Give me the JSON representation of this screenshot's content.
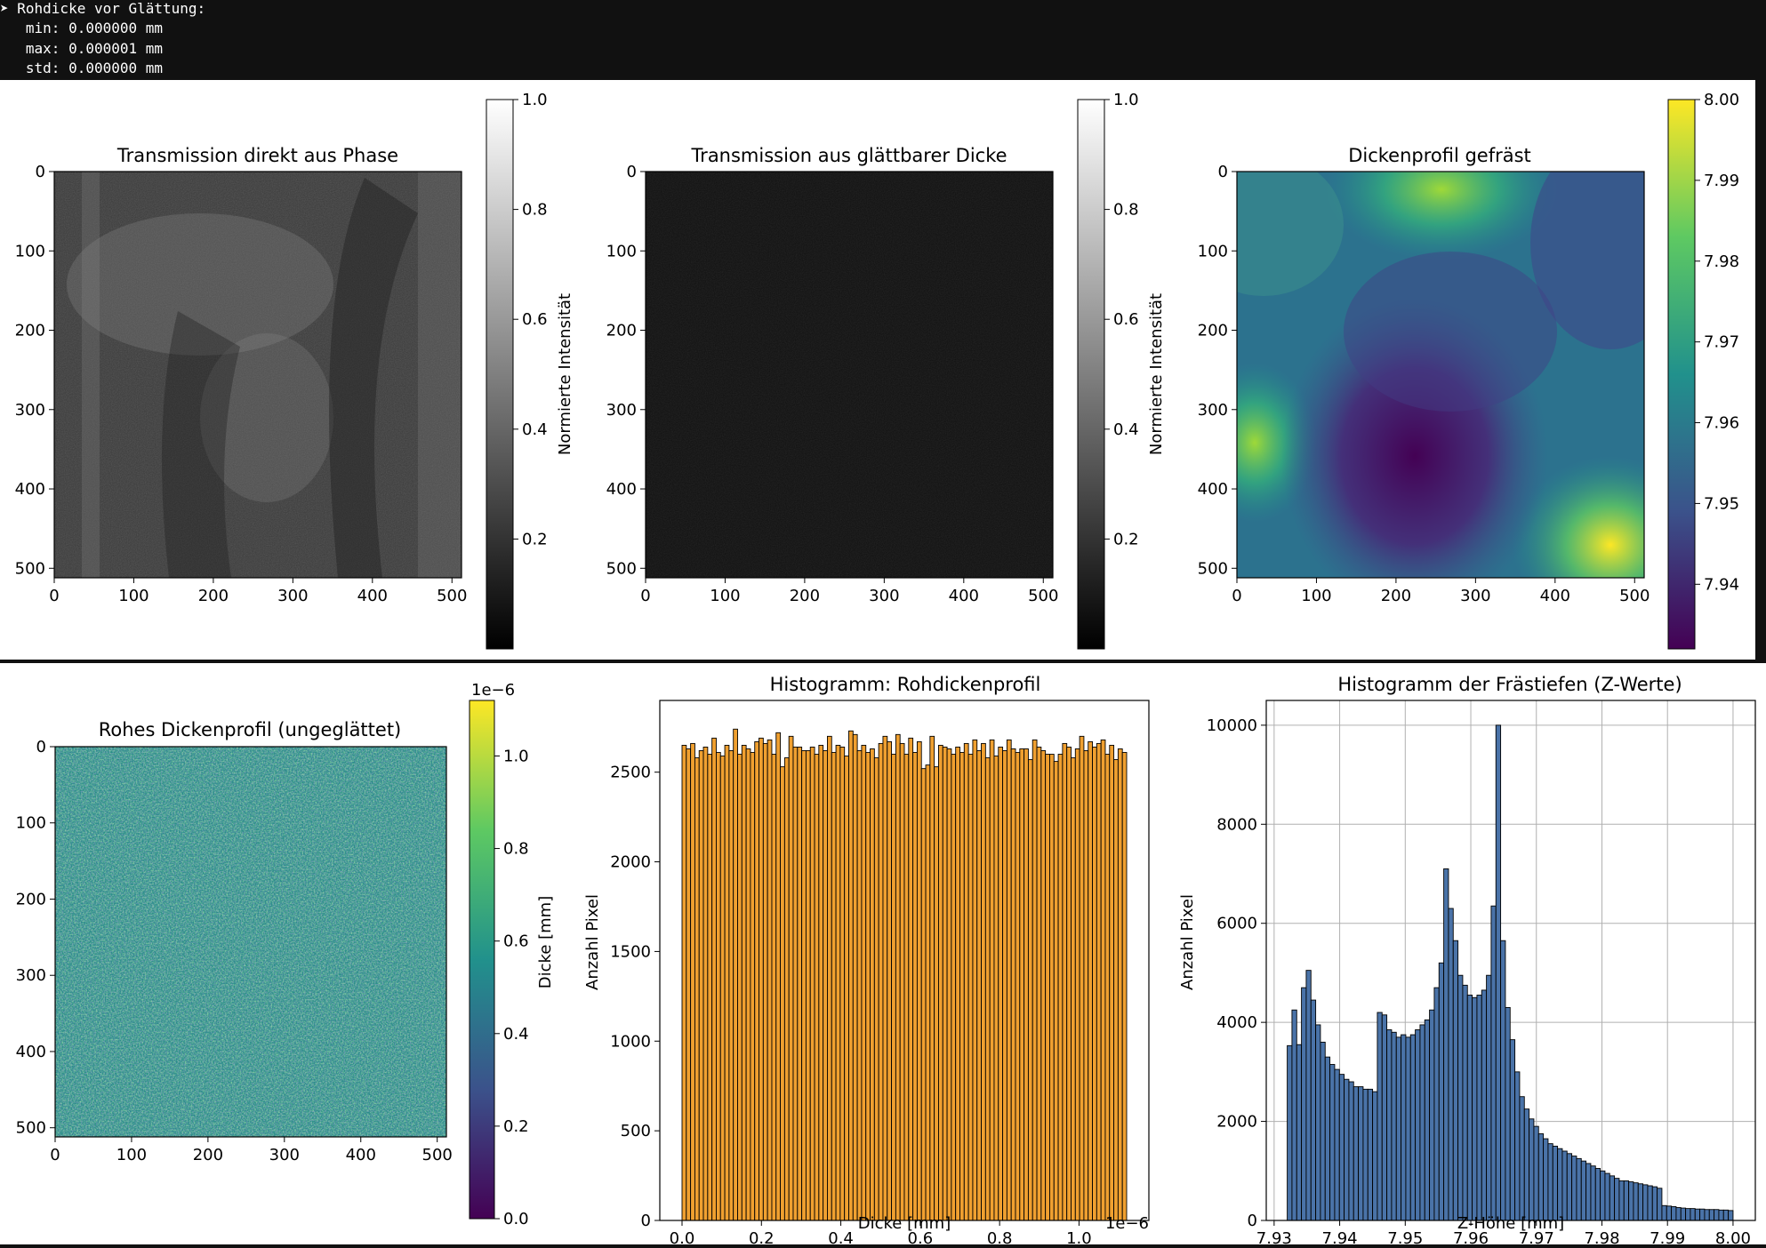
{
  "console": {
    "lines": [
      "➤ Rohdicke vor Glättung:",
      "   min: 0.000000 mm",
      "   max: 0.000001 mm",
      "   std: 0.000000 mm"
    ]
  },
  "colors": {
    "background": "#111111",
    "figure_bg": "#ffffff",
    "hist_orange": "#f0a030",
    "hist_steelblue": "#4a73a8",
    "grid": "#b0b0b0"
  },
  "chart_data": [
    {
      "type": "heatmap",
      "title": "Transmission direkt aus Phase",
      "colormap": "gray",
      "xlim": [
        0,
        512
      ],
      "ylim": [
        512,
        0
      ],
      "xticks": [
        0,
        100,
        200,
        300,
        400,
        500
      ],
      "yticks": [
        0,
        100,
        200,
        300,
        400,
        500
      ],
      "colorbar": {
        "label": "Normierte Intensität",
        "range": [
          0.0,
          1.0
        ],
        "ticks": [
          0.2,
          0.4,
          0.6,
          0.8,
          1.0
        ]
      },
      "description_level": 0.3
    },
    {
      "type": "heatmap",
      "title": "Transmission aus glättbarer Dicke",
      "colormap": "gray",
      "xlim": [
        0,
        512
      ],
      "ylim": [
        512,
        0
      ],
      "xticks": [
        0,
        100,
        200,
        300,
        400,
        500
      ],
      "yticks": [
        0,
        100,
        200,
        300,
        400,
        500
      ],
      "colorbar": {
        "label": "Normierte Intensität",
        "range": [
          0.0,
          1.0
        ],
        "ticks": [
          0.2,
          0.4,
          0.6,
          0.8,
          1.0
        ]
      },
      "description_level": 0.08
    },
    {
      "type": "heatmap",
      "title": "Dickenprofil gefräst",
      "colormap": "viridis",
      "xlim": [
        0,
        512
      ],
      "ylim": [
        512,
        0
      ],
      "xticks": [
        0,
        100,
        200,
        300,
        400,
        500
      ],
      "yticks": [
        0,
        100,
        200,
        300,
        400,
        500
      ],
      "colorbar": {
        "label": "",
        "range": [
          7.932,
          8.0
        ],
        "ticks": [
          7.94,
          7.95,
          7.96,
          7.97,
          7.98,
          7.99,
          8.0
        ],
        "tick_labels": [
          "7.94",
          "7.95",
          "7.96",
          "7.97",
          "7.98",
          "7.99",
          "8.00"
        ]
      }
    },
    {
      "type": "heatmap",
      "title": "Rohes Dickenprofil (ungeglättet)",
      "colormap": "viridis",
      "xlim": [
        0,
        512
      ],
      "ylim": [
        512,
        0
      ],
      "xticks": [
        0,
        100,
        200,
        300,
        400,
        500
      ],
      "yticks": [
        0,
        100,
        200,
        300,
        400,
        500
      ],
      "colorbar": {
        "label": "Dicke [mm]",
        "range": [
          0.0,
          1.12
        ],
        "ticks": [
          0.0,
          0.2,
          0.4,
          0.6,
          0.8,
          1.0
        ],
        "tick_labels": [
          "0.0",
          "0.2",
          "0.4",
          "0.6",
          "0.8",
          "1.0"
        ],
        "offset_text": "1e−6"
      }
    },
    {
      "type": "bar",
      "title": "Histogramm: Rohdickenprofil",
      "xlabel": "Dicke [mm]",
      "ylabel": "Anzahl Pixel",
      "xlim": [
        -0.056,
        1.176
      ],
      "ylim": [
        0,
        2900
      ],
      "xticks": [
        0.0,
        0.2,
        0.4,
        0.6,
        0.8,
        1.0
      ],
      "xtick_labels": [
        "0.0",
        "0.2",
        "0.4",
        "0.6",
        "0.8",
        "1.0"
      ],
      "yticks": [
        0,
        500,
        1000,
        1500,
        2000,
        2500
      ],
      "x_offset_text": "1e−6",
      "bin_start": 0.0,
      "bin_end": 1.12,
      "values": [
        2650,
        2630,
        2660,
        2580,
        2620,
        2640,
        2600,
        2690,
        2610,
        2590,
        2650,
        2620,
        2740,
        2600,
        2650,
        2630,
        2610,
        2670,
        2690,
        2660,
        2680,
        2600,
        2720,
        2530,
        2580,
        2700,
        2640,
        2640,
        2620,
        2620,
        2640,
        2600,
        2650,
        2620,
        2700,
        2610,
        2650,
        2640,
        2590,
        2730,
        2710,
        2620,
        2650,
        2610,
        2630,
        2580,
        2660,
        2700,
        2670,
        2600,
        2710,
        2660,
        2600,
        2690,
        2610,
        2670,
        2520,
        2540,
        2700,
        2530,
        2650,
        2640,
        2630,
        2600,
        2640,
        2610,
        2660,
        2600,
        2680,
        2620,
        2660,
        2580,
        2680,
        2590,
        2640,
        2620,
        2680,
        2630,
        2610,
        2630,
        2630,
        2570,
        2680,
        2640,
        2620,
        2600,
        2600,
        2560,
        2600,
        2660,
        2640,
        2580,
        2630,
        2700,
        2620,
        2670,
        2640,
        2660,
        2680,
        2600,
        2650,
        2570,
        2630,
        2610
      ],
      "bar_color": "#f0a030"
    },
    {
      "type": "bar",
      "title": "Histogramm der Frästiefen (Z-Werte)",
      "xlabel": "Z-Höhe [mm]",
      "ylabel": "Anzahl Pixel",
      "xlim": [
        7.9288,
        8.0034
      ],
      "ylim": [
        0,
        10500
      ],
      "xticks": [
        7.93,
        7.94,
        7.95,
        7.96,
        7.97,
        7.98,
        7.99,
        8.0
      ],
      "xtick_labels": [
        "7.93",
        "7.94",
        "7.95",
        "7.96",
        "7.97",
        "7.98",
        "7.99",
        "8.00"
      ],
      "yticks": [
        0,
        2000,
        4000,
        6000,
        8000,
        10000
      ],
      "grid": true,
      "bin_start": 7.932,
      "bin_end": 8.0,
      "values": [
        3530,
        4250,
        3550,
        4700,
        5050,
        4450,
        3950,
        3600,
        3300,
        3150,
        3050,
        2950,
        2850,
        2800,
        2700,
        2700,
        2650,
        2650,
        2600,
        4200,
        4150,
        3850,
        3800,
        3700,
        3750,
        3700,
        3750,
        3850,
        3950,
        4050,
        4250,
        4700,
        5200,
        7100,
        6300,
        5650,
        4950,
        4750,
        4550,
        4500,
        4550,
        4650,
        4950,
        6350,
        10000,
        5650,
        4300,
        3650,
        3000,
        2500,
        2250,
        2050,
        1900,
        1750,
        1650,
        1550,
        1500,
        1450,
        1400,
        1350,
        1300,
        1250,
        1200,
        1150,
        1100,
        1050,
        1000,
        950,
        900,
        850,
        800,
        800,
        780,
        760,
        740,
        720,
        700,
        680,
        650,
        300,
        290,
        280,
        260,
        250,
        240,
        240,
        230,
        230,
        220,
        220,
        220,
        210,
        210,
        200
      ],
      "bar_color": "#4a73a8"
    }
  ]
}
